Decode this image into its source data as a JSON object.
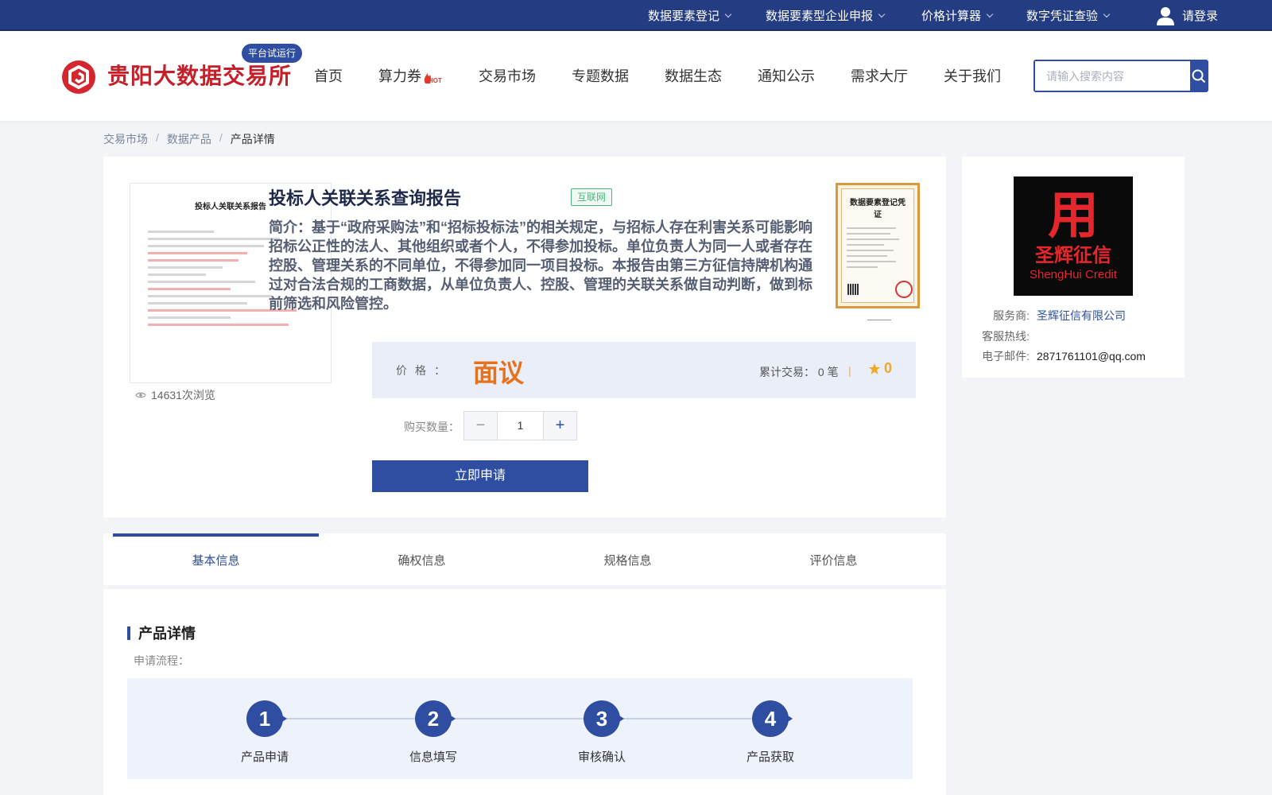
{
  "topbar": {
    "menus": [
      {
        "label": "数据要素登记"
      },
      {
        "label": "数据要素型企业申报"
      },
      {
        "label": "价格计算器"
      },
      {
        "label": "数字凭证查验"
      }
    ],
    "login_label": "请登录"
  },
  "header": {
    "logo_text": "贵阳大数据交易所",
    "trial_badge": "平台试运行",
    "nav": [
      {
        "label": "首页"
      },
      {
        "label": "算力券"
      },
      {
        "label": "交易市场"
      },
      {
        "label": "专题数据"
      },
      {
        "label": "数据生态"
      },
      {
        "label": "通知公示"
      },
      {
        "label": "需求大厅"
      },
      {
        "label": "关于我们"
      }
    ],
    "hot_badge": "HOT",
    "search_placeholder": "请输入搜索内容"
  },
  "breadcrumb": [
    "交易市场",
    "数据产品",
    "产品详情"
  ],
  "product": {
    "title": "投标人关联关系查询报告",
    "tag": "互联网",
    "description": "简介：基于“政府采购法”和“招标投标法”的相关规定，与招标人存在利害关系可能影响招标公正性的法人、其他组织或者个人，不得参加投标。单位负责人为同一人或者存在控股、管理关系的不同单位，不得参加同一项目投标。本报告由第三方征信持牌机构通过对合法合规的工商数据，从单位负责人、控股、管理的关联关系做自动判断，做到标前筛选和风险管控。",
    "thumb_title": "投标人关联关系报告",
    "views": "14631次浏览",
    "cert_title": "数据要素登记凭证",
    "price_label": "价格：",
    "price_value": "面议",
    "trade_label": "累计交易：",
    "trade_count": "0",
    "trade_unit": "笔",
    "rating": "0",
    "quantity_label": "购买数量：",
    "quantity": "1",
    "apply_label": "立即申请"
  },
  "vendor": {
    "logo_text_en": "ShengHui Credit",
    "logo_text_zh": "圣辉征信",
    "provider_label": "服务商:",
    "provider_name": "圣辉征信有限公司",
    "hotline_label": "客服热线:",
    "hotline_value": "",
    "email_label": "电子邮件:",
    "email_value": "2871761101@qq.com"
  },
  "tabs": [
    {
      "label": "基本信息"
    },
    {
      "label": "确权信息"
    },
    {
      "label": "规格信息"
    },
    {
      "label": "评价信息"
    }
  ],
  "detail": {
    "section_title": "产品详情",
    "flow_label": "申请流程：",
    "steps": [
      {
        "num": "1",
        "label": "产品申请"
      },
      {
        "num": "2",
        "label": "信息填写"
      },
      {
        "num": "3",
        "label": "审核确认"
      },
      {
        "num": "4",
        "label": "产品获取"
      }
    ]
  },
  "colors": {
    "brand": "#2f4ea1",
    "topbar": "#243d82",
    "logo_red": "#c5202a",
    "price_orange": "#e8721c"
  }
}
